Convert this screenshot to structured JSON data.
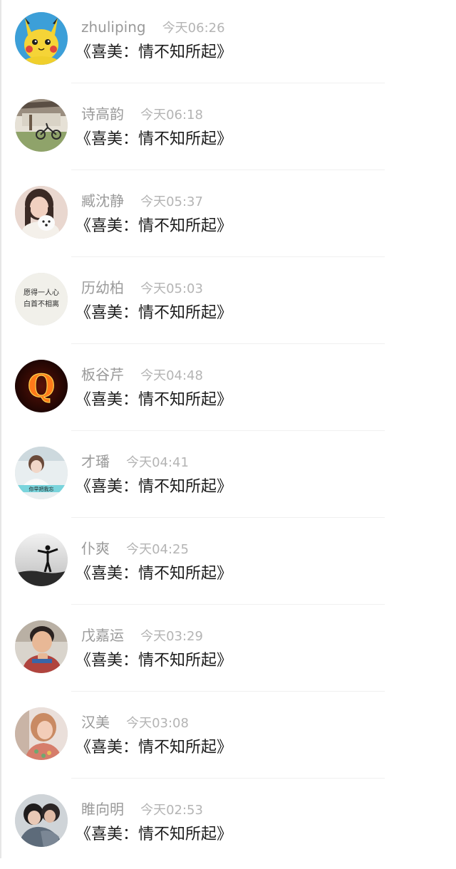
{
  "comments": [
    {
      "user": "zhuliping",
      "time": "今天06:26",
      "content": "《喜美：情不知所起》",
      "avatar": "pikachu-avatar"
    },
    {
      "user": "诗高韵",
      "time": "今天06:18",
      "content": "《喜美：情不知所起》",
      "avatar": "bicycle-photo-avatar"
    },
    {
      "user": "臧沈静",
      "time": "今天05:37",
      "content": "《喜美：情不知所起》",
      "avatar": "girl-with-dog-avatar"
    },
    {
      "user": "历幼柏",
      "time": "今天05:03",
      "content": "《喜美：情不知所起》",
      "avatar": "handwritten-text-avatar",
      "avatar_text": [
        "愿得一人心",
        "白首不相离"
      ]
    },
    {
      "user": "板谷芹",
      "time": "今天04:48",
      "content": "《喜美：情不知所起》",
      "avatar": "fire-letter-q-avatar",
      "avatar_text": [
        "Q"
      ]
    },
    {
      "user": "才璠",
      "time": "今天04:41",
      "content": "《喜美：情不知所起》",
      "avatar": "girl-with-caption-avatar",
      "avatar_text": [
        "你早把我忘"
      ]
    },
    {
      "user": "仆爽",
      "time": "今天04:25",
      "content": "《喜美：情不知所起》",
      "avatar": "silhouette-avatar"
    },
    {
      "user": "戊嘉运",
      "time": "今天03:29",
      "content": "《喜美：情不知所起》",
      "avatar": "child-avatar"
    },
    {
      "user": "汉美",
      "time": "今天03:08",
      "content": "《喜美：情不知所起》",
      "avatar": "woman-portrait-avatar"
    },
    {
      "user": "睢向明",
      "time": "今天02:53",
      "content": "《喜美：情不知所起》",
      "avatar": "couple-avatar"
    }
  ],
  "colors": {
    "name": "#9a9a9a",
    "time": "#b4b4b4",
    "content": "#1c1c1c",
    "divider": "#f0f0f0",
    "background": "#ffffff"
  }
}
